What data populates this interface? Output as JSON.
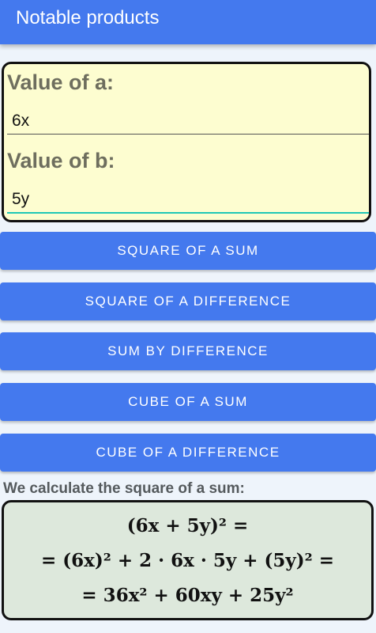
{
  "app": {
    "title": "Notable products"
  },
  "inputs": {
    "a_label": "Value of a:",
    "a_value": "6x",
    "b_label": "Value of b:",
    "b_value": "5y"
  },
  "buttons": {
    "square_sum": "SQUARE OF A SUM",
    "square_difference": "SQUARE OF A DIFFERENCE",
    "sum_by_difference": "SUM BY DIFFERENCE",
    "cube_sum": "CUBE OF A SUM",
    "cube_difference": "CUBE OF A DIFFERENCE"
  },
  "result": {
    "caption": "We calculate the square of a sum:",
    "lines": [
      "(6x + 5y)² =",
      "= (6x)² + 2 · 6x · 5y + (5y)² =",
      "= 36x² + 60xy + 25y²"
    ]
  },
  "colors": {
    "primary": "#4479ee",
    "input_card_bg": "#fdfdd0",
    "result_card_bg": "#dde8dc",
    "focus_accent": "#1fc7b6"
  }
}
